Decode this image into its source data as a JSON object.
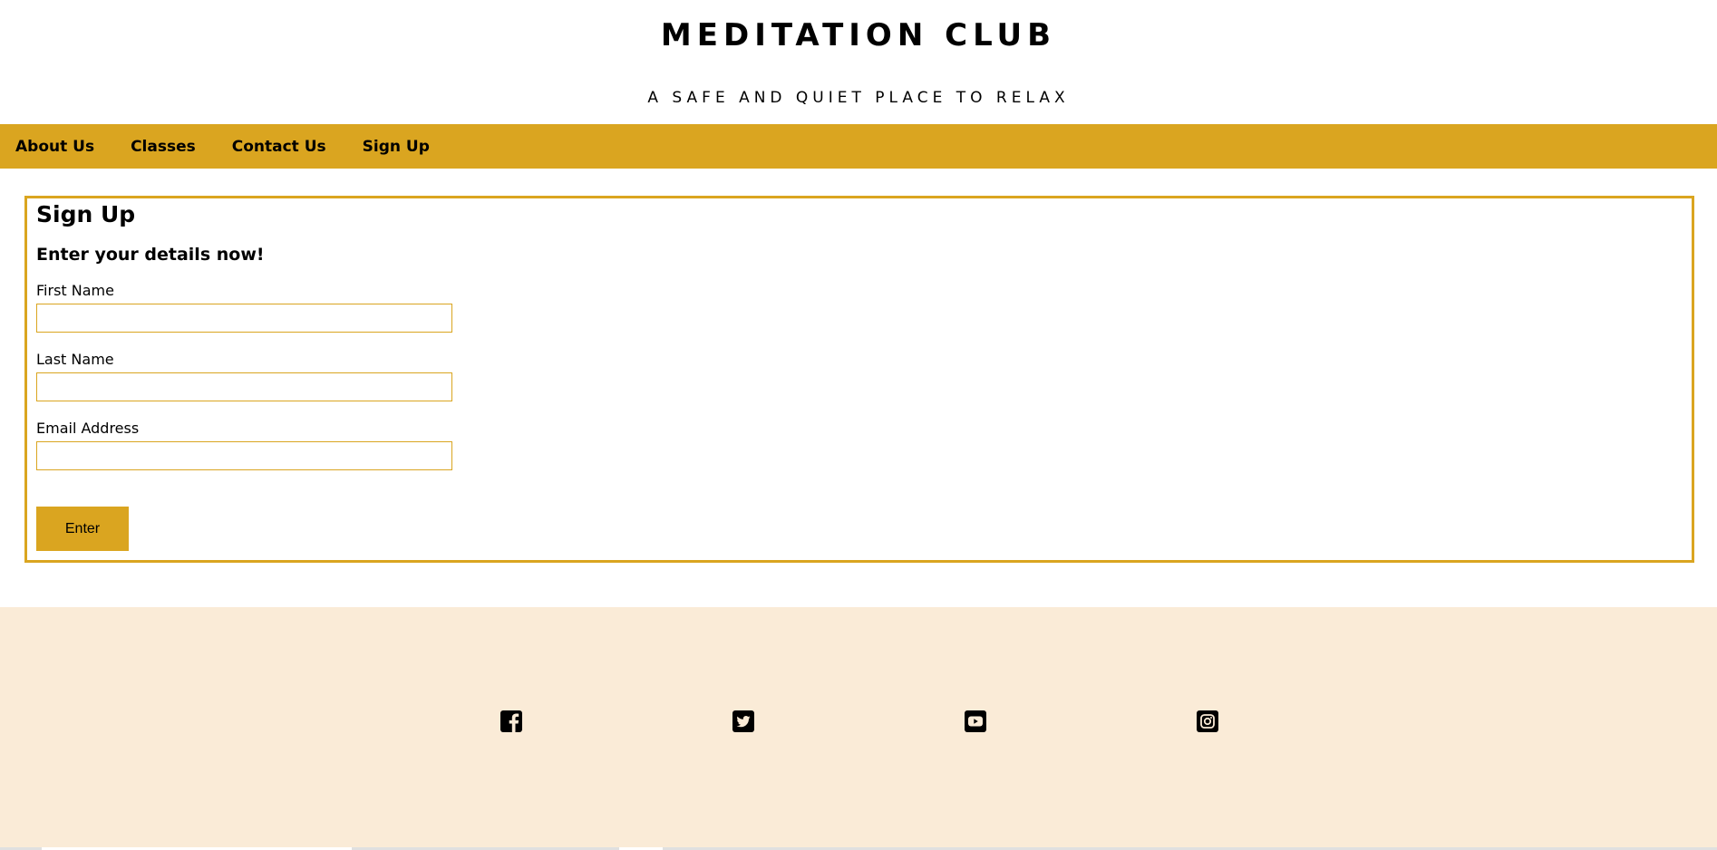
{
  "header": {
    "title": "MEDITATION CLUB",
    "tagline": "A SAFE AND QUIET PLACE TO RELAX"
  },
  "nav": {
    "items": [
      {
        "label": "About Us"
      },
      {
        "label": "Classes"
      },
      {
        "label": "Contact Us"
      },
      {
        "label": "Sign Up"
      }
    ]
  },
  "signup": {
    "title": "Sign Up",
    "subtitle": "Enter your details now!",
    "fields": [
      {
        "label": "First Name",
        "value": ""
      },
      {
        "label": "Last Name",
        "value": ""
      },
      {
        "label": "Email Address",
        "value": ""
      }
    ],
    "submit_label": "Enter"
  },
  "footer": {
    "social_icons": [
      "facebook-icon",
      "twitter-icon",
      "youtube-icon",
      "instagram-icon"
    ]
  },
  "colors": {
    "accent": "#daa520",
    "footer_bg": "#faebd7",
    "text": "#000000"
  }
}
